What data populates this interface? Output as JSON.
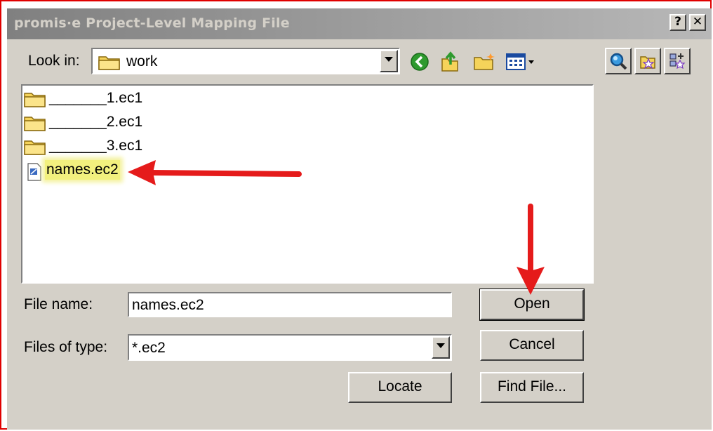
{
  "window": {
    "title": "promis·e Project-Level Mapping File",
    "help_label": "?",
    "close_label": "✕"
  },
  "lookin": {
    "label": "Look in:",
    "value": "work"
  },
  "files": [
    {
      "name": "_______1.ec1",
      "type": "folder"
    },
    {
      "name": "_______2.ec1",
      "type": "folder"
    },
    {
      "name": "_______3.ec1",
      "type": "folder"
    },
    {
      "name": "names.ec2",
      "type": "file",
      "selected": true
    }
  ],
  "filename": {
    "label": "File name:",
    "value": "names.ec2"
  },
  "filetype": {
    "label": "Files of type:",
    "value": "*.ec2"
  },
  "buttons": {
    "open": "Open",
    "cancel": "Cancel",
    "locate": "Locate",
    "find_file": "Find File..."
  },
  "colors": {
    "annotation_arrow": "#e51b1b",
    "highlight": "#f2f07e",
    "frame": "#e00000"
  },
  "icons": [
    "folder-icon",
    "back-icon",
    "up-folder-icon",
    "new-folder-icon",
    "view-menu-icon",
    "search-icon",
    "star-folder-icon",
    "add-star-icon",
    "document-icon"
  ]
}
